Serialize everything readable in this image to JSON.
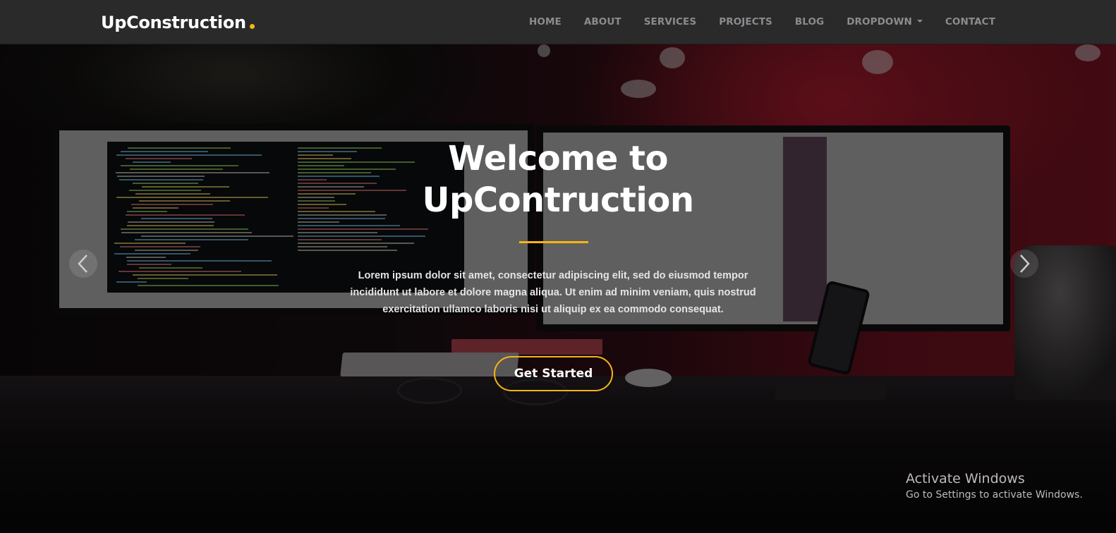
{
  "header": {
    "brand": "UpConstruction",
    "nav": [
      {
        "label": "HOME"
      },
      {
        "label": "ABOUT"
      },
      {
        "label": "SERVICES"
      },
      {
        "label": "PROJECTS"
      },
      {
        "label": "BLOG"
      },
      {
        "label": "DROPDOWN",
        "has_dropdown": true
      },
      {
        "label": "CONTACT"
      }
    ]
  },
  "hero": {
    "title_line1": "Welcome to",
    "title_line2": "UpContruction",
    "text": "Lorem ipsum dolor sit amet, consectetur adipiscing elit, sed do eiusmod tempor incididunt ut labore et dolore magna aliqua. Ut enim ad minim veniam, quis nostrud exercitation ullamco laboris nisi ut aliquip ex ea commodo consequat.",
    "cta_label": "Get Started",
    "prev_icon": "chevron-left-icon",
    "next_icon": "chevron-right-icon"
  },
  "watermark": {
    "title": "Activate Windows",
    "subtitle": "Go to Settings to activate Windows."
  },
  "colors": {
    "accent": "#f7b512",
    "navbar_bg": "#2b2a2b",
    "nav_text": "#8b8c8f"
  }
}
